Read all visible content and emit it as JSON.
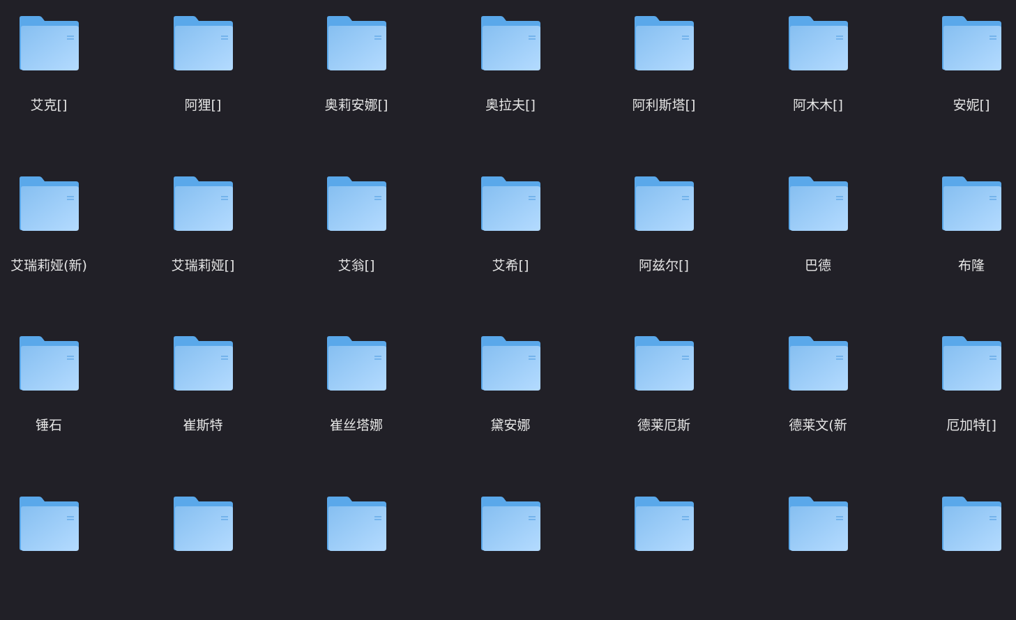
{
  "folder_icon": "folder-icon",
  "colors": {
    "background": "#212027",
    "folder_back": "#5aa8ea",
    "folder_front_top": "#86bff1",
    "folder_front_bottom": "#b4dbff",
    "label": "#e6e6e6"
  },
  "folders": [
    {
      "label": "艾克[]"
    },
    {
      "label": "阿狸[]"
    },
    {
      "label": "奥莉安娜[]"
    },
    {
      "label": "奥拉夫[]"
    },
    {
      "label": "阿利斯塔[]"
    },
    {
      "label": "阿木木[]"
    },
    {
      "label": "安妮[]"
    },
    {
      "label": "艾瑞莉娅(新)"
    },
    {
      "label": "艾瑞莉娅[]"
    },
    {
      "label": "艾翁[]"
    },
    {
      "label": "艾希[]"
    },
    {
      "label": "阿兹尔[]"
    },
    {
      "label": "巴德"
    },
    {
      "label": "布隆"
    },
    {
      "label": "锤石"
    },
    {
      "label": "崔斯特"
    },
    {
      "label": "崔丝塔娜"
    },
    {
      "label": "黛安娜"
    },
    {
      "label": "德莱厄斯"
    },
    {
      "label": "德莱文(新"
    },
    {
      "label": "厄加特[]"
    },
    {
      "label": ""
    },
    {
      "label": ""
    },
    {
      "label": ""
    },
    {
      "label": ""
    },
    {
      "label": ""
    },
    {
      "label": ""
    },
    {
      "label": ""
    }
  ]
}
